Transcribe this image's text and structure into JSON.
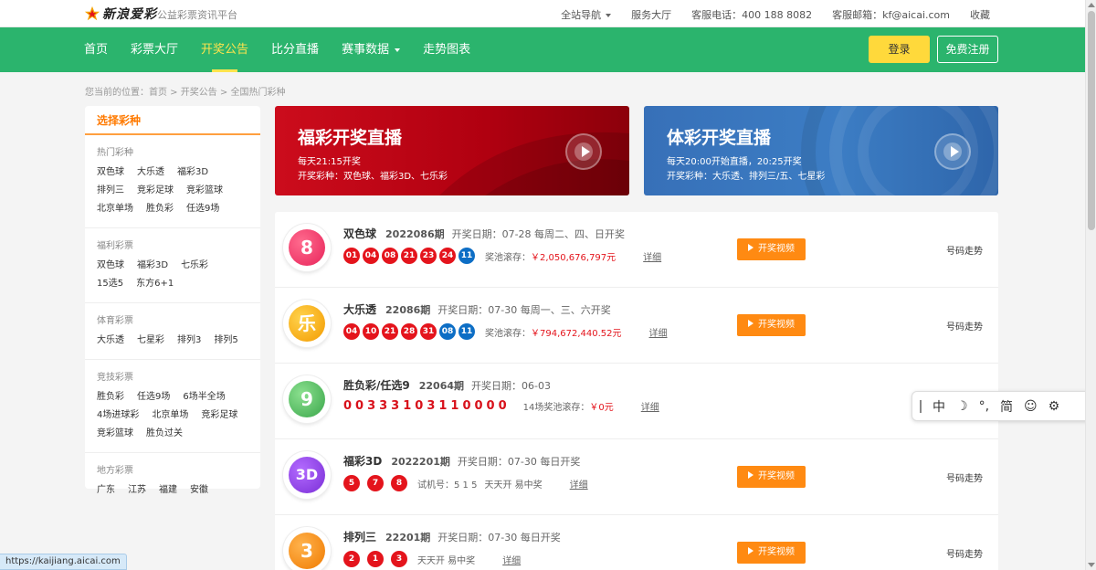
{
  "topbar": {
    "logo_text": "新浪爱彩",
    "tagline": "公益彩票资讯平台",
    "links": [
      "全站导航",
      "服务大厅",
      "客服电话：400 188 8082",
      "客服邮箱：kf@aicai.com",
      "收藏"
    ]
  },
  "nav": {
    "items": [
      "首页",
      "彩票大厅",
      "开奖公告",
      "比分直播",
      "赛事数据",
      "走势图表"
    ],
    "active": "开奖公告",
    "login": "登录",
    "register": "免费注册"
  },
  "breadcrumb": "您当前的位置：首页 > 开奖公告 > 全国热门彩种",
  "sidebar": {
    "title": "选择彩种",
    "groups": [
      {
        "title": "热门彩种",
        "items": [
          "双色球",
          "大乐透",
          "福彩3D",
          "排列三",
          "竞彩足球",
          "竞彩篮球",
          "北京单场",
          "胜负彩",
          "任选9场"
        ]
      },
      {
        "title": "福利彩票",
        "items": [
          "双色球",
          "福彩3D",
          "七乐彩",
          "15选5",
          "东方6+1"
        ]
      },
      {
        "title": "体育彩票",
        "items": [
          "大乐透",
          "七星彩",
          "排列3",
          "排列5"
        ]
      },
      {
        "title": "竞技彩票",
        "items": [
          "胜负彩",
          "任选9场",
          "6场半全场",
          "4场进球彩",
          "北京单场",
          "竞彩足球",
          "竞彩篮球",
          "胜负过关"
        ]
      },
      {
        "title": "地方彩票",
        "items": [
          "广东",
          "江苏",
          "福建",
          "安徽"
        ]
      }
    ]
  },
  "banners": {
    "fucai": {
      "title": "福彩开奖直播",
      "line1": "每天21:15开奖",
      "line2": "开奖彩种：双色球、福彩3D、七乐彩"
    },
    "ticai": {
      "title": "体彩开奖直播",
      "line1": "每天20:00开始直播，20:25开奖",
      "line2": "开奖彩种：大乐透、排列三/五、七星彩"
    }
  },
  "lotteries": [
    {
      "name": "双色球",
      "issue": "2022086期",
      "date": "开奖日期：07-28 每周二、四、日开奖",
      "icon_text": "8",
      "red": [
        "01",
        "04",
        "08",
        "21",
        "23",
        "24"
      ],
      "blue": [
        "11"
      ],
      "pool_label": "奖池滚存：",
      "pool_value": "￥2,050,676,797元",
      "detail": "详细",
      "video": "开奖视频",
      "trend": "号码走势"
    },
    {
      "name": "大乐透",
      "issue": "22086期",
      "date": "开奖日期：07-30 每周一、三、六开奖",
      "icon_text": "乐",
      "red": [
        "04",
        "10",
        "21",
        "28",
        "31"
      ],
      "blue": [
        "08",
        "11"
      ],
      "pool_label": "奖池滚存：",
      "pool_value": "￥794,672,440.52元",
      "detail": "详细",
      "video": "开奖视频",
      "trend": "号码走势"
    },
    {
      "name": "胜负彩/任选9",
      "issue": "22064期",
      "date": "开奖日期：06-03",
      "icon_text": "9",
      "digits": "00333103110000",
      "pool_label": "14场奖池滚存：",
      "pool_value": "￥0元",
      "detail": "详细"
    },
    {
      "name": "福彩3D",
      "issue": "2022201期",
      "date": "开奖日期：07-30 每日开奖",
      "icon_text": "3D",
      "red": [
        "5",
        "7",
        "8"
      ],
      "trial": "试机号：5 1 5",
      "trial2": "天天开 易中奖",
      "detail": "详细",
      "video": "开奖视频",
      "trend": "号码走势"
    },
    {
      "name": "排列三",
      "issue": "22201期",
      "date": "开奖日期：07-30 每日开奖",
      "icon_text": "3",
      "red": [
        "2",
        "1",
        "3"
      ],
      "trial2": "天天开 易中奖",
      "detail": "详细",
      "video": "开奖视频",
      "trend": "号码走势"
    }
  ],
  "ime": {
    "items": [
      "中",
      "☽",
      "°,",
      "简",
      "☺",
      "⚙"
    ]
  },
  "status_url": "https://kaijiang.aicai.com",
  "colors": {
    "nav_green": "#2bb46d",
    "accent_orange": "#ff8a12",
    "ball_red": "#e4141c",
    "ball_blue": "#0d6ec5",
    "login_yellow": "#ffd93b"
  }
}
